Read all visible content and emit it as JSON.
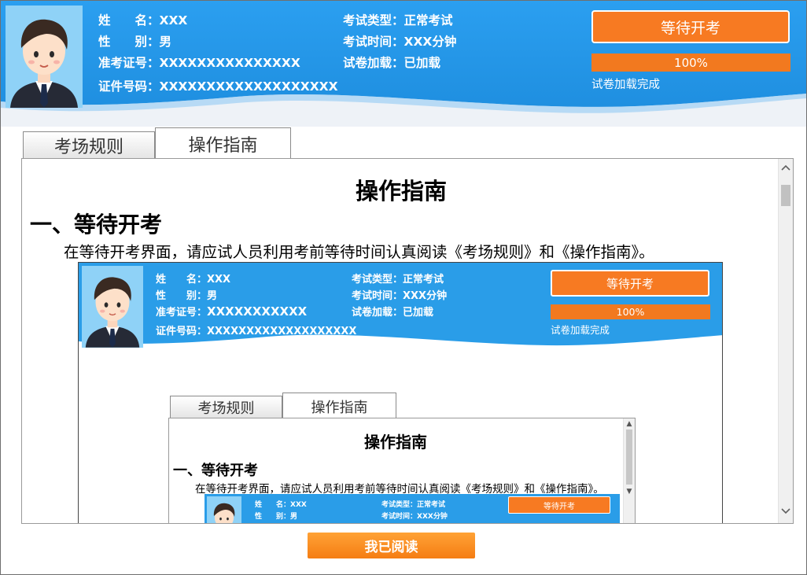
{
  "header": {
    "name_label": "姓　　名：",
    "name_value": "XXX",
    "gender_label": "性　　别：",
    "gender_value": "男",
    "admission_label": "准考证号：",
    "admission_value": "XXXXXXXXXXXXXXX",
    "id_label": "证件号码：",
    "id_value": "XXXXXXXXXXXXXXXXXXX",
    "exam_type_label": "考试类型：",
    "exam_type_value": "正常考试",
    "exam_time_label": "考试时间：",
    "exam_time_value": "XXX分钟",
    "paper_load_label": "试卷加载：",
    "paper_load_value": "已加载",
    "start_button": "等待开考",
    "progress_percent": 100,
    "progress_label": "100%",
    "progress_status": "试卷加载完成"
  },
  "tabs": [
    {
      "label": "考场规则",
      "active": false
    },
    {
      "label": "操作指南",
      "active": true
    }
  ],
  "content": {
    "title": "操作指南",
    "section1_heading": "一、等待开考",
    "section1_text": "在等待开考界面，请应试人员利用考前等待时间认真阅读《考场规则》和《操作指南》。"
  },
  "embedded": {
    "name_label": "姓　　名：",
    "name_value": "XXX",
    "gender_label": "性　　别：",
    "gender_value": "男",
    "admission_label": "准考证号：",
    "admission_value": "XXXXXXXXXXX",
    "id_label": "证件号码：",
    "id_value": "XXXXXXXXXXXXXXXXXXX",
    "exam_type_label": "考试类型：",
    "exam_type_value": "正常考试",
    "exam_time_label": "考试时间：",
    "exam_time_value": "XXX分钟",
    "paper_load_label": "试卷加载：",
    "paper_load_value": "已加载",
    "start_button": "等待开考",
    "progress_label": "100%",
    "progress_status": "试卷加载完成",
    "tab_rules": "考场规则",
    "tab_guide": "操作指南",
    "title": "操作指南",
    "section1_heading": "一、等待开考",
    "section1_text": "在等待开考界面，请应试人员利用考前等待时间认真阅读《考场规则》和《操作指南》。",
    "nested_name": "姓　　名：XXX",
    "nested_gender": "性　　别：男",
    "nested_type": "考试类型：正常考试",
    "nested_time": "考试时间：XXX分钟",
    "nested_button": "等待开考"
  },
  "footer": {
    "read_button": "我已阅读"
  },
  "colors": {
    "header_blue": "#2a9de8",
    "accent_orange": "#f77a22"
  }
}
